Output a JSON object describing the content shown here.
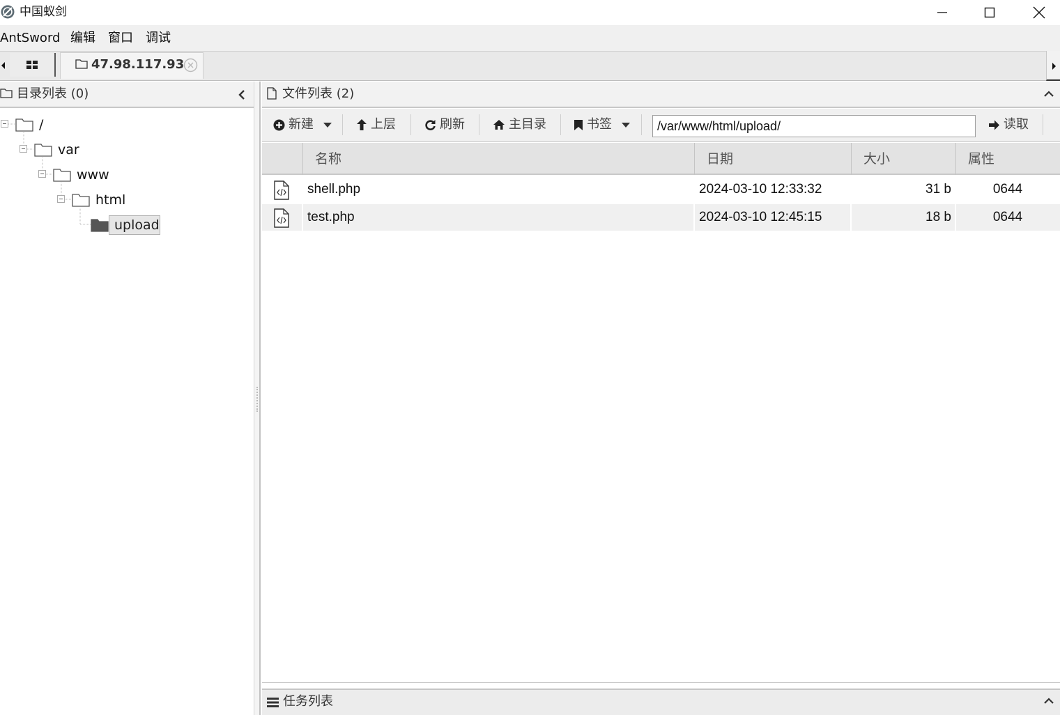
{
  "window": {
    "title": "中国蚁剑"
  },
  "menu": [
    "AntSword",
    "编辑",
    "窗口",
    "调试"
  ],
  "tabs": {
    "active_label": "47.98.117.93"
  },
  "left_panel": {
    "title": "目录列表 (0)",
    "tree": [
      {
        "label": "/",
        "depth": 0
      },
      {
        "label": "var",
        "depth": 1
      },
      {
        "label": "www",
        "depth": 2
      },
      {
        "label": "html",
        "depth": 3
      },
      {
        "label": "upload",
        "depth": 4,
        "selected": true
      }
    ]
  },
  "right_panel": {
    "title": "文件列表 (2)",
    "toolbar": {
      "new": "新建",
      "up": "上层",
      "refresh": "刷新",
      "home": "主目录",
      "bookmark": "书签",
      "path": "/var/www/html/upload/",
      "read": "读取"
    },
    "columns": [
      "名称",
      "日期",
      "大小",
      "属性"
    ],
    "files": [
      {
        "name": "shell.php",
        "date": "2024-03-10 12:33:32",
        "size": "31 b",
        "perm": "0644",
        "icon": "php-file-icon"
      },
      {
        "name": "test.php",
        "date": "2024-03-10 12:45:15",
        "size": "18 b",
        "perm": "0644",
        "icon": "php-file-icon"
      }
    ]
  },
  "task_panel": {
    "title": "任务列表"
  }
}
